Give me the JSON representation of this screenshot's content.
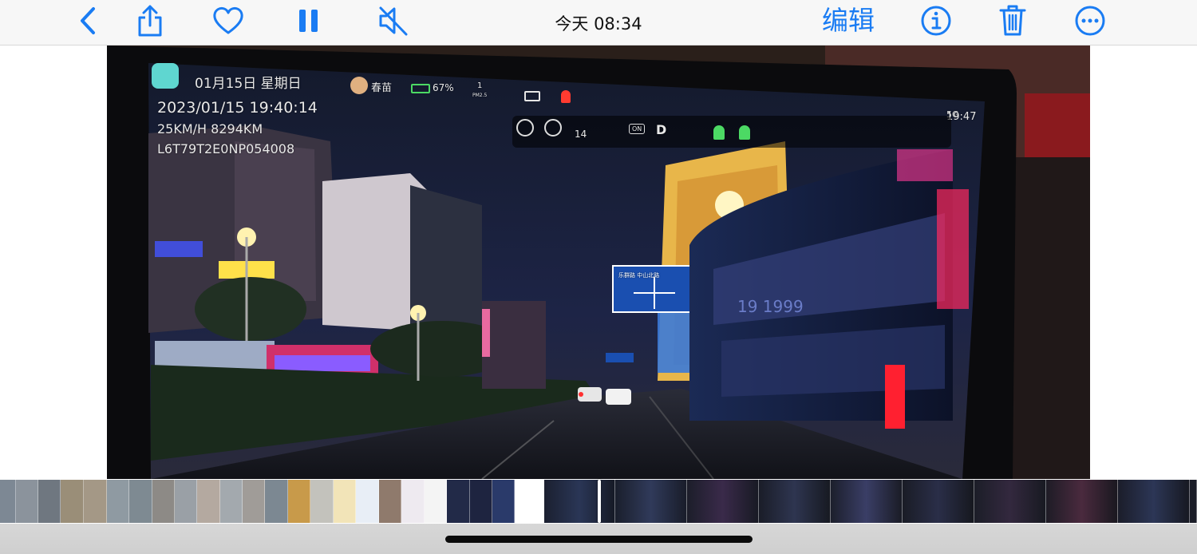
{
  "toolbar": {
    "title": "今天  08:34",
    "edit_label": "编辑",
    "icons": [
      "back-chevron-icon",
      "share-icon",
      "heart-icon",
      "pause-icon",
      "mute-icon",
      "info-icon",
      "trash-icon",
      "more-icon"
    ],
    "accent_color": "#1a7cf3"
  },
  "video": {
    "hud_date": "01月15日 星期日",
    "hud_user": "春苗",
    "hud_battery": "67%",
    "hud_pm": "1",
    "hud_pm_unit": "PM2.5",
    "hud_timestamp": "2023/01/15 19:40:14",
    "hud_speed": "25KM/H 8294KM",
    "hud_vin": "L6T79T2E0NP054008",
    "hud_clock": "19:47",
    "hud_signal": "5G",
    "hud_status_count": "14",
    "hud_gear": "D",
    "hud_camera_label": "ON",
    "sign_text": "乐群路 中山北路",
    "bus_text": "19 1999"
  },
  "filmstrip": {
    "thumbnail_count": 27,
    "selected_frame": "current-video"
  }
}
